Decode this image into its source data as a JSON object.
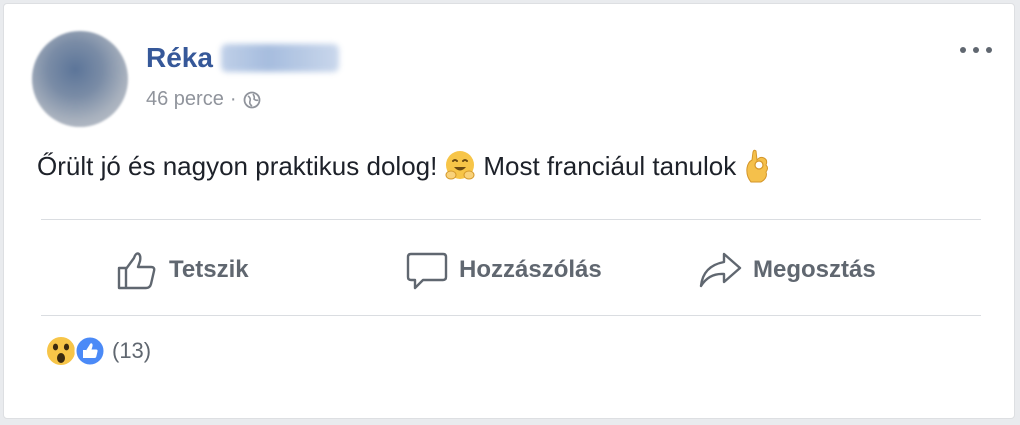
{
  "post": {
    "author_first": "Réka",
    "time": "46 perce",
    "separator": "·",
    "text_part1": "Őrült jó és nagyon praktikus dolog!",
    "text_part2": "Most franciául tanulok"
  },
  "actions": {
    "like": "Tetszik",
    "comment": "Hozzászólás",
    "share": "Megosztás"
  },
  "reactions": {
    "count": "(13)"
  },
  "icons": {
    "more": "more-options-icon",
    "privacy": "globe-icon",
    "emoji1": "hugging-face-icon",
    "emoji2": "ok-hand-icon",
    "like": "thumbs-up-icon",
    "comment": "speech-bubble-icon",
    "share": "share-arrow-icon",
    "wow": "wow-reaction-icon",
    "like_reaction": "like-reaction-icon"
  },
  "colors": {
    "name": "#365899",
    "meta": "#90949c",
    "action": "#606770",
    "like_blue": "#4b8af7",
    "emoji_yellow": "#f7c548"
  }
}
